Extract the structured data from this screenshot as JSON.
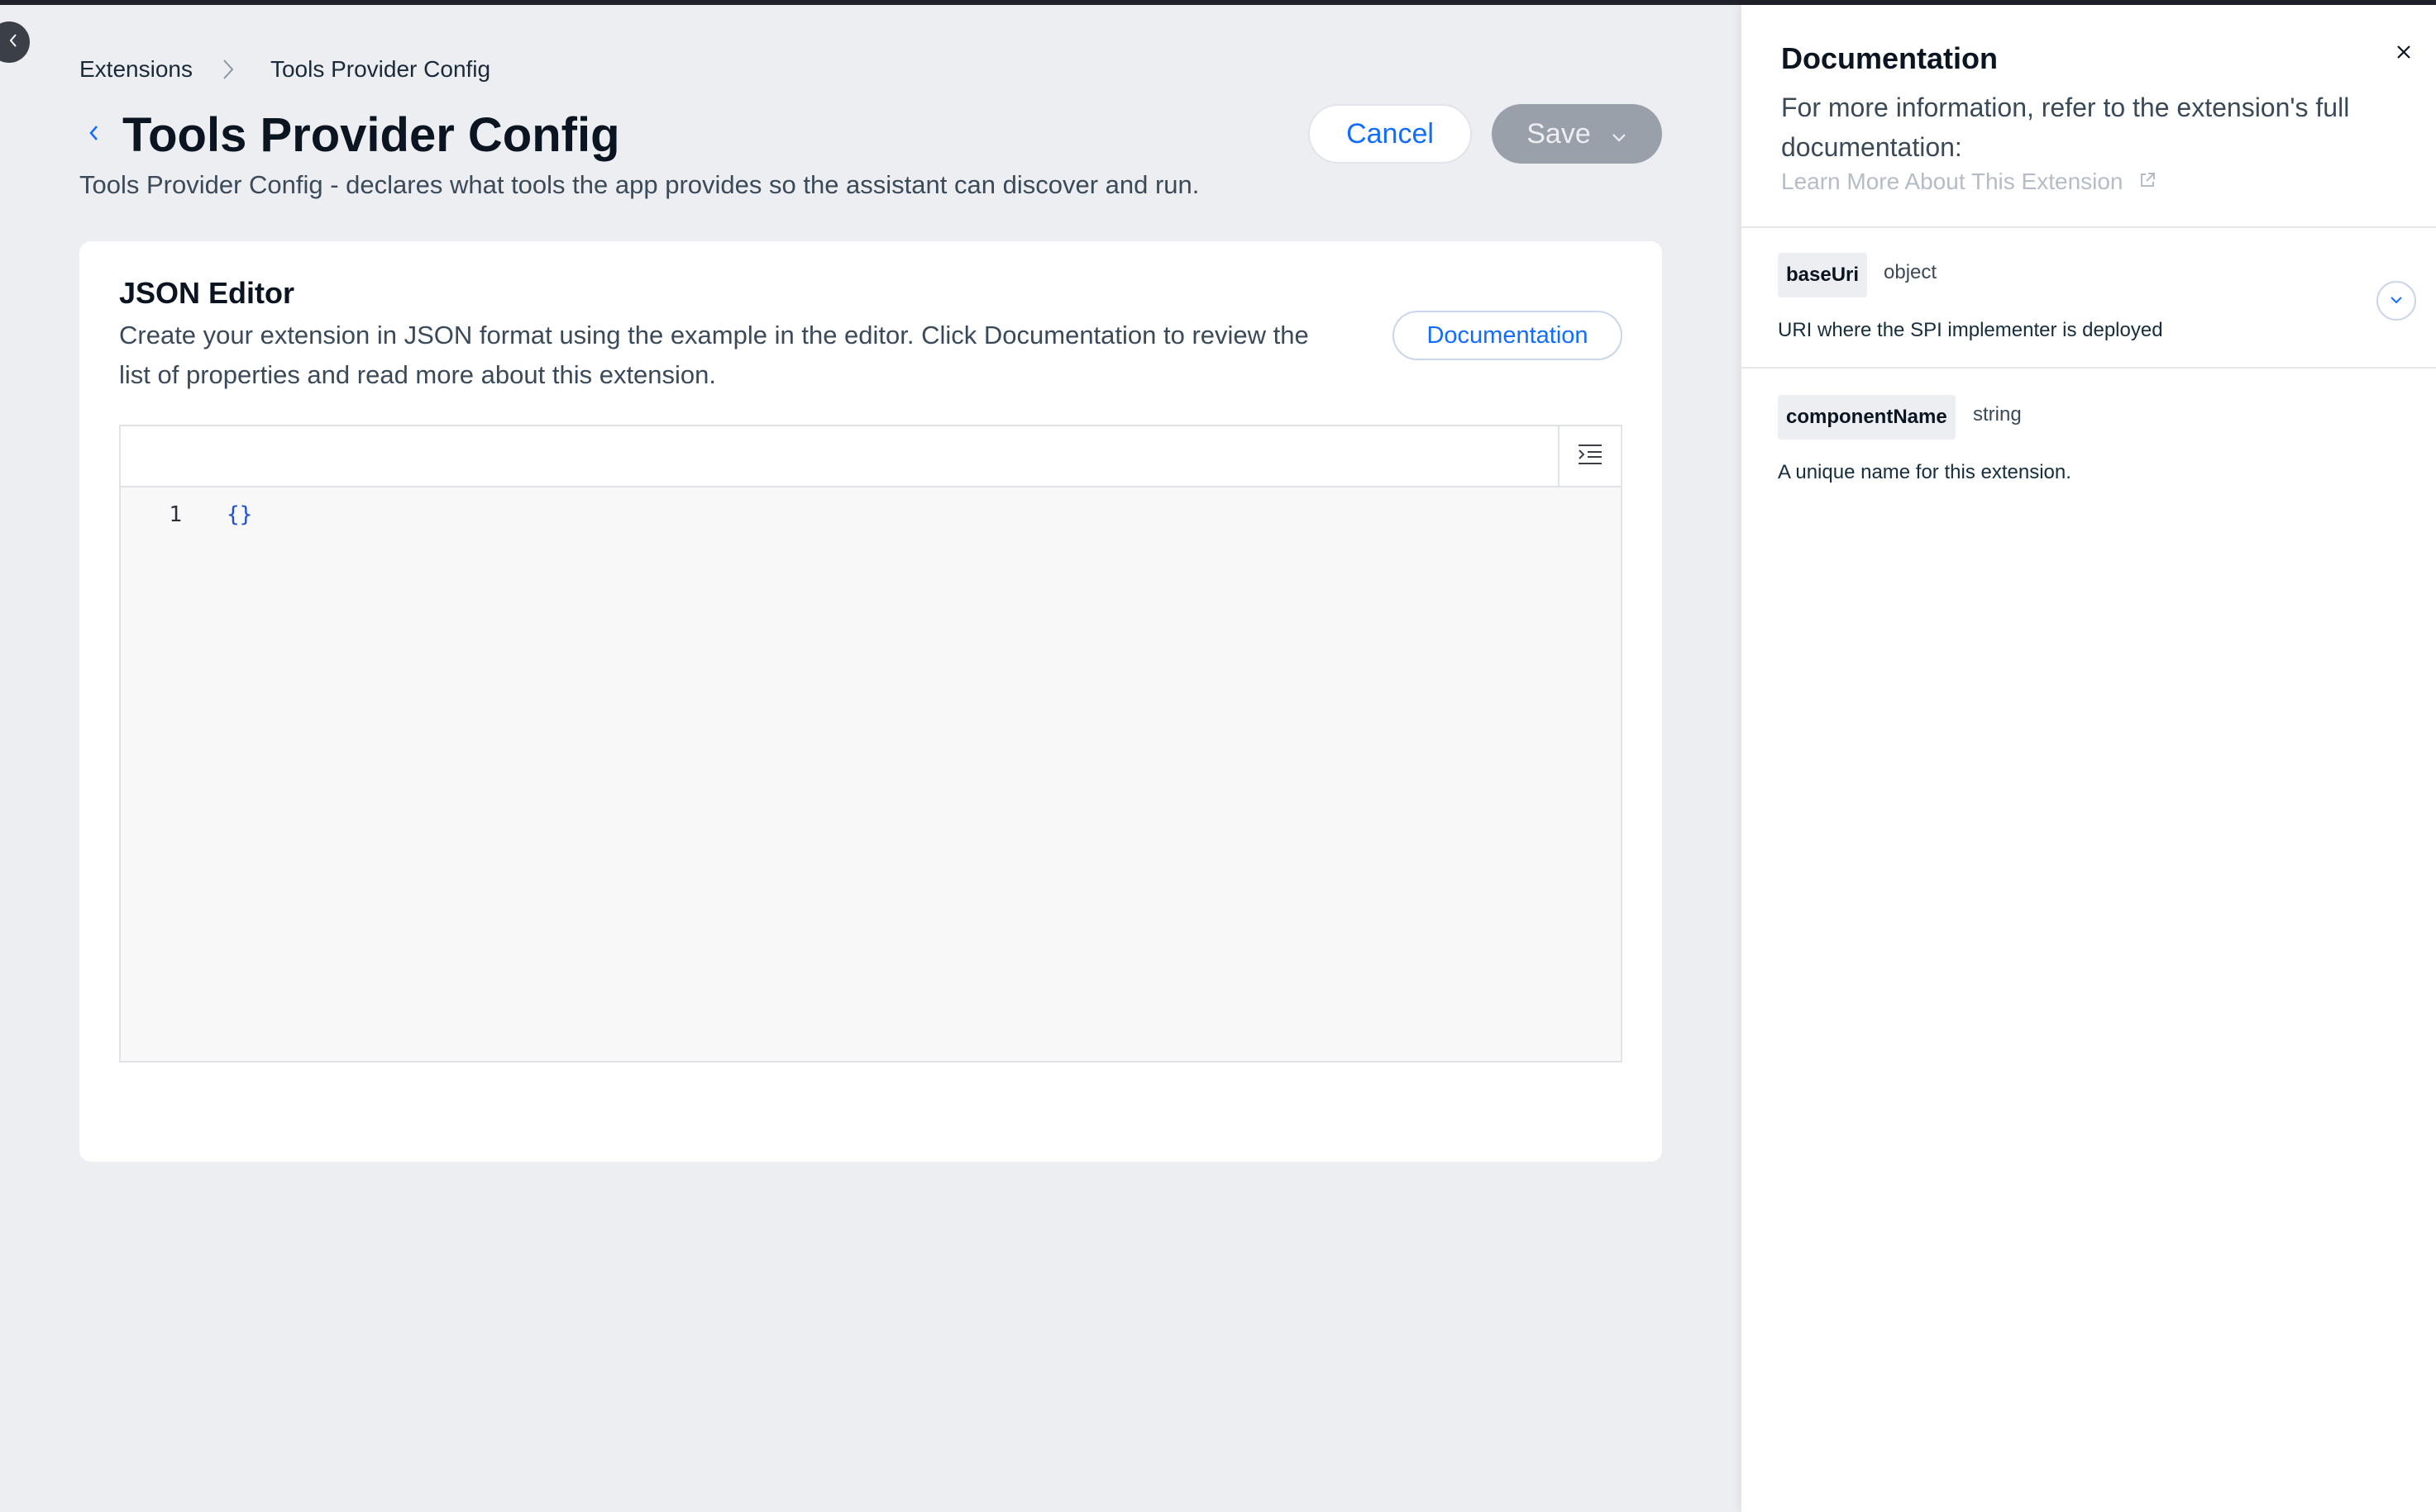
{
  "breadcrumb": {
    "items": [
      "Extensions",
      "Tools Provider Config"
    ]
  },
  "header": {
    "title": "Tools Provider Config",
    "subtitle": "Tools Provider Config - declares what tools the app provides so the assistant can discover and run.",
    "cancel_label": "Cancel",
    "save_label": "Save"
  },
  "editor_card": {
    "title": "JSON Editor",
    "description": "Create your extension in JSON format using the example in the editor. Click Documentation to review the list of properties and read more about this extension.",
    "doc_button_label": "Documentation",
    "code_lines": [
      {
        "number": "1",
        "text": "{}"
      }
    ]
  },
  "panel": {
    "title": "Documentation",
    "intro": "For more information, refer to the extension's full documentation:",
    "link_label": "Learn More About This Extension",
    "properties": [
      {
        "name": "baseUri",
        "type": "object",
        "description": "URI where the SPI implementer is deployed",
        "expandable": true
      },
      {
        "name": "componentName",
        "type": "string",
        "description": "A unique name for this extension.",
        "expandable": false
      }
    ]
  },
  "colors": {
    "accent": "#116dff",
    "save_disabled": "#9aa0aa",
    "page_bg": "#edeef2"
  },
  "icons": [
    "chevron-left-icon",
    "chevron-right-icon",
    "chevron-down-icon",
    "format-icon",
    "close-icon",
    "external-link-icon"
  ]
}
